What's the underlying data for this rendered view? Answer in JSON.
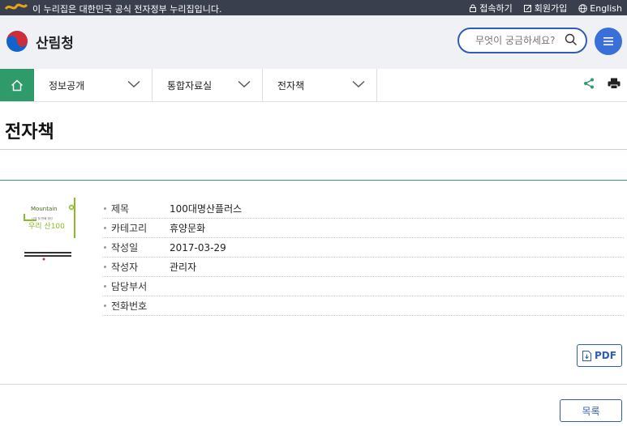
{
  "topbar": {
    "gov_notice": "이 누리집은 대한민국 공식 전자정부 누리집입니다.",
    "links": [
      {
        "label": "접속하기",
        "icon": "lock-icon"
      },
      {
        "label": "회원가입",
        "icon": "edit-icon"
      },
      {
        "label": "English",
        "icon": "globe-icon"
      }
    ]
  },
  "header": {
    "org_name": "산림청",
    "search_placeholder": "무엇이 궁금하세요?",
    "menu_icon": "hamburger-menu-icon"
  },
  "nav": {
    "home_icon": "home-icon",
    "items": [
      {
        "label": "정보공개"
      },
      {
        "label": "통합자료실"
      },
      {
        "label": "전자책"
      }
    ],
    "tools": [
      "share-icon",
      "print-icon"
    ]
  },
  "page": {
    "title": "전자책"
  },
  "book": {
    "cover": {
      "brand": "Mountain",
      "subtitle": "나의 첫 번째 명산",
      "title": "우리 산100"
    },
    "fields": [
      {
        "key": "제목",
        "value": "100대명산플러스"
      },
      {
        "key": "카테고리",
        "value": "휴양문화"
      },
      {
        "key": "작성일",
        "value": "2017-03-29"
      },
      {
        "key": "작성자",
        "value": "관리자"
      },
      {
        "key": "담당부서",
        "value": ""
      },
      {
        "key": "전화번호",
        "value": ""
      }
    ]
  },
  "actions": {
    "pdf_label": "PDF",
    "list_label": "목록"
  },
  "colors": {
    "accent_green": "#2f9b6b",
    "accent_blue": "#2f5db4",
    "topbar_bg": "#3a3f4e",
    "header_bg": "#f0f1f5"
  }
}
